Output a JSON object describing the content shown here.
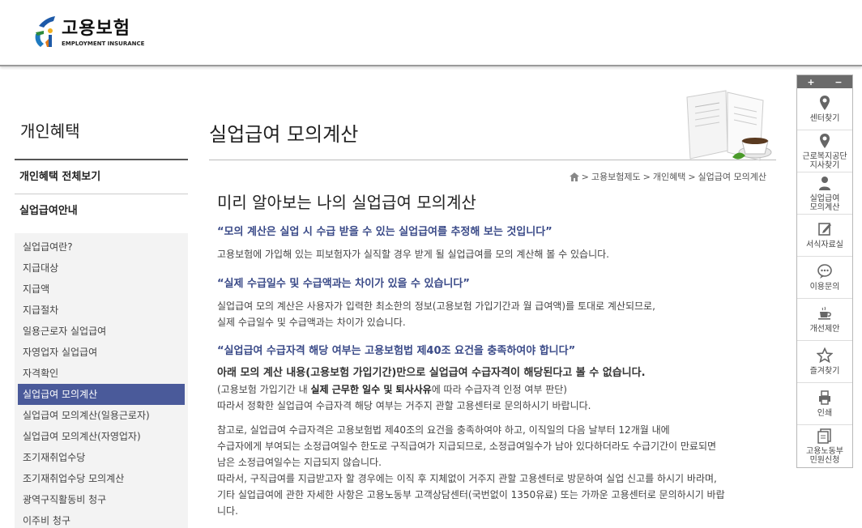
{
  "header": {
    "logo_kr": "고용보험",
    "logo_en": "EMPLOYMENT INSURANCE"
  },
  "sidebar": {
    "title": "개인혜택",
    "main_items": [
      "개인혜택 전체보기",
      "실업급여안내"
    ],
    "sub_items": [
      {
        "label": "실업급여란?"
      },
      {
        "label": "지급대상"
      },
      {
        "label": "지급액"
      },
      {
        "label": "지급절차"
      },
      {
        "label": "일용근로자 실업급여"
      },
      {
        "label": "자영업자 실업급여"
      },
      {
        "label": "자격확인"
      },
      {
        "label": "실업급여 모의계산",
        "active": true
      },
      {
        "label": "실업급여 모의계산(일용근로자)"
      },
      {
        "label": "실업급여 모의계산(자영업자)"
      },
      {
        "label": "조기재취업수당"
      },
      {
        "label": "조기재취업수당 모의계산"
      },
      {
        "label": "광역구직활동비 청구"
      },
      {
        "label": "이주비 청구"
      }
    ]
  },
  "main": {
    "title": "실업급여 모의계산",
    "breadcrumb": [
      "고용보험제도",
      "개인혜택",
      "실업급여 모의계산"
    ],
    "heading": "미리 알아보는 나의 실업급여 모의계산",
    "q1": "“모의 계산은 실업 시 수급 받을 수 있는 실업급여를 추정해 보는 것입니다”",
    "p1": "고용보험에 가입해 있는 피보험자가 실직할 경우 받게 될 실업급여를 모의 계산해 볼 수 있습니다.",
    "q2": "“실제 수급일수 및 수급액과는 차이가 있을 수 있습니다”",
    "p2a": "실업급여 모의 계산은 사용자가 입력한 최소한의 정보(고용보험 가입기간과 월 급여액)를 토대로 계산되므로,",
    "p2b": "실제 수급일수 및 수급액과는 차이가 있습니다.",
    "q3": "“실업급여 수급자격 해당 여부는 고용보험법 제40조 요건을 충족하여야 합니다”",
    "p3_strong": "아래 모의 계산 내용(고용보험 가입기간)만으로 실업급여 수급자격이 해당된다고 볼 수 없습니다.",
    "p3b_pre": "(고용보험 가입기간 내 ",
    "p3b_bold": "실제 근무한 일수 및 퇴사사유",
    "p3b_post": "에 따라 수급자격 인정 여부 판단)",
    "p3c": "따라서 정확한 실업급여 수급자격 해당 여부는 거주지 관할 고용센터로 문의하시기 바랍니다.",
    "p4a": "참고로, 실업급여 수급자격은 고용보험법 제40조의 요건을 충족하여야 하고, 이직일의 다음 날부터 12개월 내에",
    "p4b": "수급자에게 부여되는 소정급여일수 한도로 구직급여가 지급되므로, 소정급여일수가 남아 있다하더라도 수급기간이 만료되면",
    "p4c": "남은 소정급여일수는 지급되지 않습니다.",
    "p4d": "따라서, 구직급여를 지급받고자 할 경우에는 이직 후 지체없이 거주지 관할 고용센터로 방문하여 실업 신고를 하시기 바라며,",
    "p4e": "기타 실업급여에 관한 자세한 사항은 고용노동부 고객상담센터(국번없이 1350유료) 또는 가까운 고용센터로 문의하시기 바랍",
    "p4f": "니다."
  },
  "quick": {
    "plus": "+",
    "minus": "−",
    "items": [
      {
        "label": "센터찾기",
        "icon": "map-pin-icon"
      },
      {
        "label": "근로복지공단\n지사찾기",
        "icon": "map-pin-icon"
      },
      {
        "label": "실업급여\n모의계산",
        "icon": "user-icon"
      },
      {
        "label": "서식자료실",
        "icon": "edit-icon"
      },
      {
        "label": "이용문의",
        "icon": "chat-icon"
      },
      {
        "label": "개선제안",
        "icon": "cup-icon"
      },
      {
        "label": "즐겨찾기",
        "icon": "star-icon"
      },
      {
        "label": "인쇄",
        "icon": "print-icon"
      },
      {
        "label": "고용노동부\n민원신청",
        "icon": "document-icon"
      }
    ]
  },
  "colors": {
    "accent": "#4a5a9a",
    "quote": "#3a4a88"
  }
}
